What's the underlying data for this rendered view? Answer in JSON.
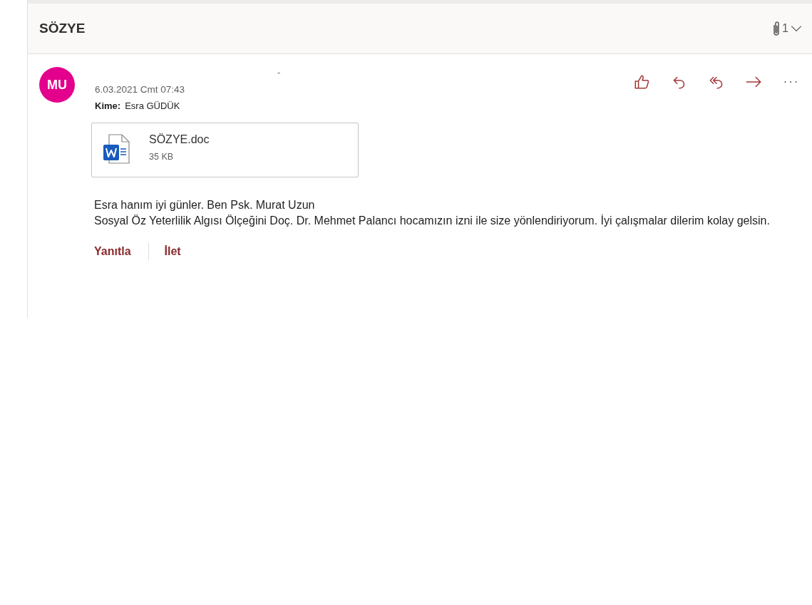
{
  "subject": "SÖZYE",
  "attachment_count": "1",
  "message": {
    "avatar_initials": "MU",
    "sender": "-",
    "date": "6.03.2021 Cmt 07:43",
    "to_label": "Kime:",
    "to": "Esra GÜDÜK",
    "attachments": [
      {
        "kind": "word",
        "name": "SÖZYE.doc",
        "size": "35 KB"
      }
    ],
    "body": [
      "Esra hanım iyi günler. Ben Psk. Murat Uzun",
      "Sosyal Öz Yeterlilik Algısı Ölçeğini Doç. Dr. Mehmet Palancı hocamızın izni ile size yönlendiriyorum. İyi çalışmalar dilerim kolay gelsin."
    ],
    "actions": [
      {
        "kind": "like"
      },
      {
        "kind": "reply"
      },
      {
        "kind": "reply-all"
      },
      {
        "kind": "forward"
      },
      {
        "kind": "more"
      }
    ],
    "footer_links": [
      "Yanıtla",
      "İlet"
    ]
  }
}
